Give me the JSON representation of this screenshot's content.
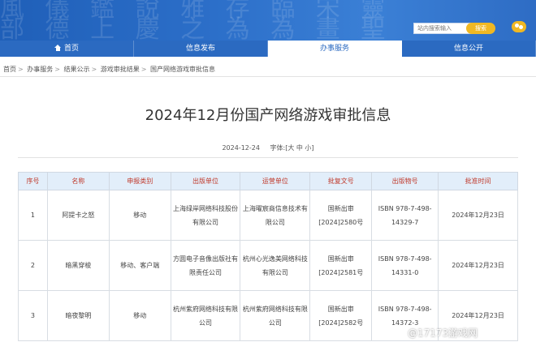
{
  "header": {
    "search_placeholder": "站内搜索输入",
    "search_button": "搜索"
  },
  "nav": {
    "items": [
      {
        "label": "首页"
      },
      {
        "label": "信息发布"
      },
      {
        "label": "办事服务"
      },
      {
        "label": "信息公开"
      }
    ]
  },
  "breadcrumb": [
    "首页",
    "办事服务",
    "结果公示",
    "游戏审批结果",
    "国产网络游戏审批信息"
  ],
  "article": {
    "title": "2024年12月份国产网络游戏审批信息",
    "date": "2024-12-24",
    "font_size_label": "字体:[大 中 小]"
  },
  "table": {
    "headers": [
      "序号",
      "名称",
      "申报类别",
      "出版单位",
      "运营单位",
      "批复文号",
      "出版物号",
      "批准时间"
    ],
    "rows": [
      [
        "1",
        "阿提卡之怒",
        "移动",
        "上海绿岸网络科技股份有限公司",
        "上海曜宸商信息技术有限公司",
        "国新出审[2024]2580号",
        "ISBN 978-7-498-14329-7",
        "2024年12月23日"
      ],
      [
        "2",
        "暗黑穿梭",
        "移动、客户端",
        "方圆电子音像出版社有限责任公司",
        "杭州心光逸美网络科技有限公司",
        "国新出审[2024]2581号",
        "ISBN 978-7-498-14331-0",
        "2024年12月23日"
      ],
      [
        "3",
        "暗夜黎明",
        "移动",
        "杭州紫府网络科技有限公司",
        "杭州紫府网络科技有限公司",
        "国新出审[2024]2582号",
        "ISBN 978-7-498-14372-3",
        "2024年12月23日"
      ]
    ]
  },
  "watermark": "@17173游戏网"
}
